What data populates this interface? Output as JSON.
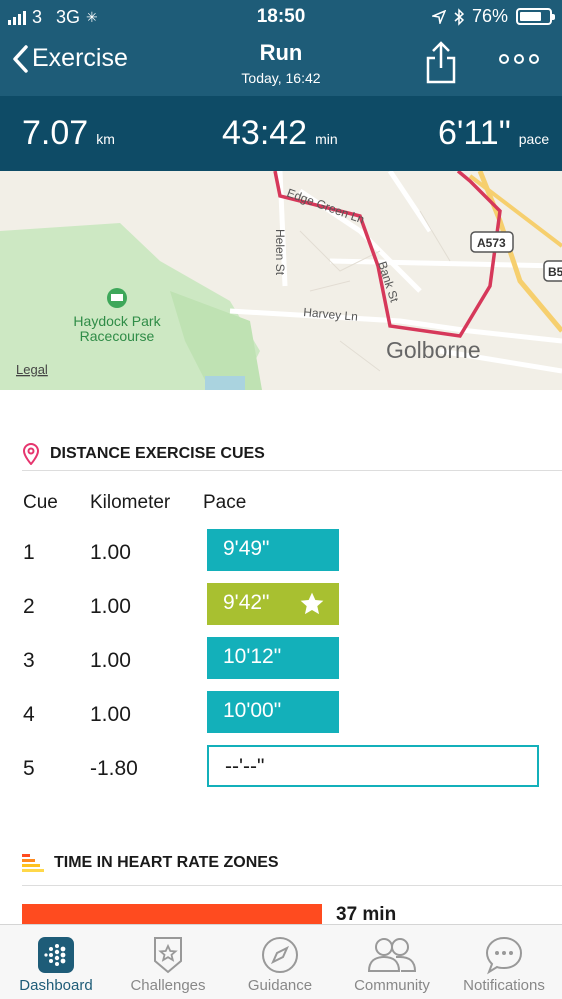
{
  "status_bar": {
    "carrier": "3",
    "network": "3G",
    "time": "18:50",
    "battery_text": "76%",
    "battery_level": 0.76
  },
  "nav": {
    "back_label": "Exercise",
    "title": "Run",
    "subtitle": "Today, 16:42"
  },
  "summary": {
    "distance": {
      "value": "7.07",
      "unit": "km"
    },
    "duration": {
      "value": "43:42",
      "unit": "min"
    },
    "pace": {
      "value": "6'11\"",
      "unit": "pace"
    }
  },
  "map": {
    "legal": "Legal",
    "labels": {
      "edge_green": "Edge Green Ln",
      "helen": "Helen St",
      "bank": "Bank St",
      "harvey": "Harvey Ln",
      "golborne": "Golborne",
      "racecourse_line1": "Haydock Park",
      "racecourse_line2": "Racecourse",
      "road_a573": "A573",
      "road_b": "B5"
    }
  },
  "cues_section": {
    "title": "DISTANCE EXERCISE CUES",
    "headers": {
      "cue": "Cue",
      "km": "Kilometer",
      "pace": "Pace"
    },
    "rows": [
      {
        "cue": "1",
        "km": "1.00",
        "pace": "9'49\"",
        "best": false
      },
      {
        "cue": "2",
        "km": "1.00",
        "pace": "9'42\"",
        "best": true
      },
      {
        "cue": "3",
        "km": "1.00",
        "pace": "10'12\"",
        "best": false
      },
      {
        "cue": "4",
        "km": "1.00",
        "pace": "10'00\"",
        "best": false
      },
      {
        "cue": "5",
        "km": "-1.80",
        "pace": "--'--\"",
        "best": false
      }
    ]
  },
  "hr_section": {
    "title": "TIME IN HEART RATE ZONES",
    "first_zone": "37 min"
  },
  "tabs": [
    {
      "label": "Dashboard",
      "icon": "dashboard-icon",
      "active": true
    },
    {
      "label": "Challenges",
      "icon": "challenges-star-icon",
      "active": false
    },
    {
      "label": "Guidance",
      "icon": "compass-icon",
      "active": false
    },
    {
      "label": "Community",
      "icon": "community-people-icon",
      "active": false
    },
    {
      "label": "Notifications",
      "icon": "chat-bubble-icon",
      "active": false
    }
  ],
  "colors": {
    "header": "#1e5c78",
    "stats_bar": "#0e4b66",
    "pace_teal": "#13b0ba",
    "pace_best": "#a8c030",
    "route": "#d6385a",
    "hr_zone": "#ff4b1f"
  }
}
